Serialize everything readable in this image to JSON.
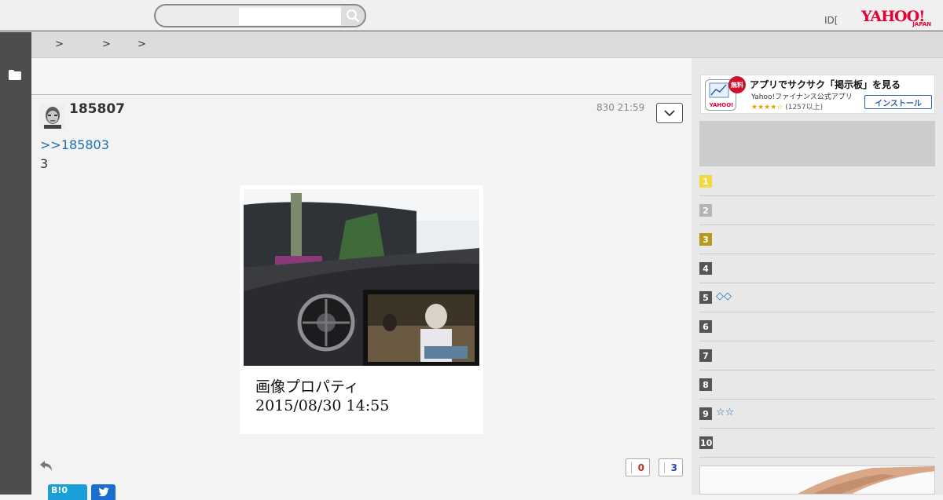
{
  "search": {
    "placeholder": ""
  },
  "header": {
    "id_label": "ID[",
    "mark": "]",
    "logo_main": "YAHOO!",
    "logo_sub": "JAPAN"
  },
  "breadcrumb": [
    ">",
    ">",
    ">"
  ],
  "post": {
    "user": "185807",
    "time": "830 21:59",
    "reply_to": ">>185803",
    "body": "3",
    "image_caption_title": "画像プロパティ",
    "image_caption_date": "2015/08/30 14:55",
    "votes_down": "0",
    "votes_up": "3",
    "hatena_label": "B!0"
  },
  "app_banner": {
    "badge": "無料",
    "title": "アプリでサクサク「掲示板」を見る",
    "subtitle": "Yahoo!ファイナンス公式アプリ",
    "stars": "★★★★☆",
    "count": "(1257以上)",
    "install": "インストール"
  },
  "ranking": [
    {
      "num": "1",
      "text": "",
      "color": "#f5d743"
    },
    {
      "num": "2",
      "text": "",
      "color": "#b5b5b5"
    },
    {
      "num": "3",
      "text": "",
      "color": "#b59a1d"
    },
    {
      "num": "4",
      "text": "",
      "color": "#555555"
    },
    {
      "num": "5",
      "text": "◇◇",
      "color": "#555555"
    },
    {
      "num": "6",
      "text": "",
      "color": "#555555"
    },
    {
      "num": "7",
      "text": "",
      "color": "#555555"
    },
    {
      "num": "8",
      "text": "",
      "color": "#555555"
    },
    {
      "num": "9",
      "text": "☆☆",
      "color": "#555555"
    },
    {
      "num": "10",
      "text": "",
      "color": "#555555"
    }
  ],
  "colors": {
    "link": "#1a6fb5",
    "nav_dark": "#4d4d4d",
    "vote_down": "#c62828",
    "vote_up": "#2745b5",
    "logo_red": "#e60033"
  }
}
